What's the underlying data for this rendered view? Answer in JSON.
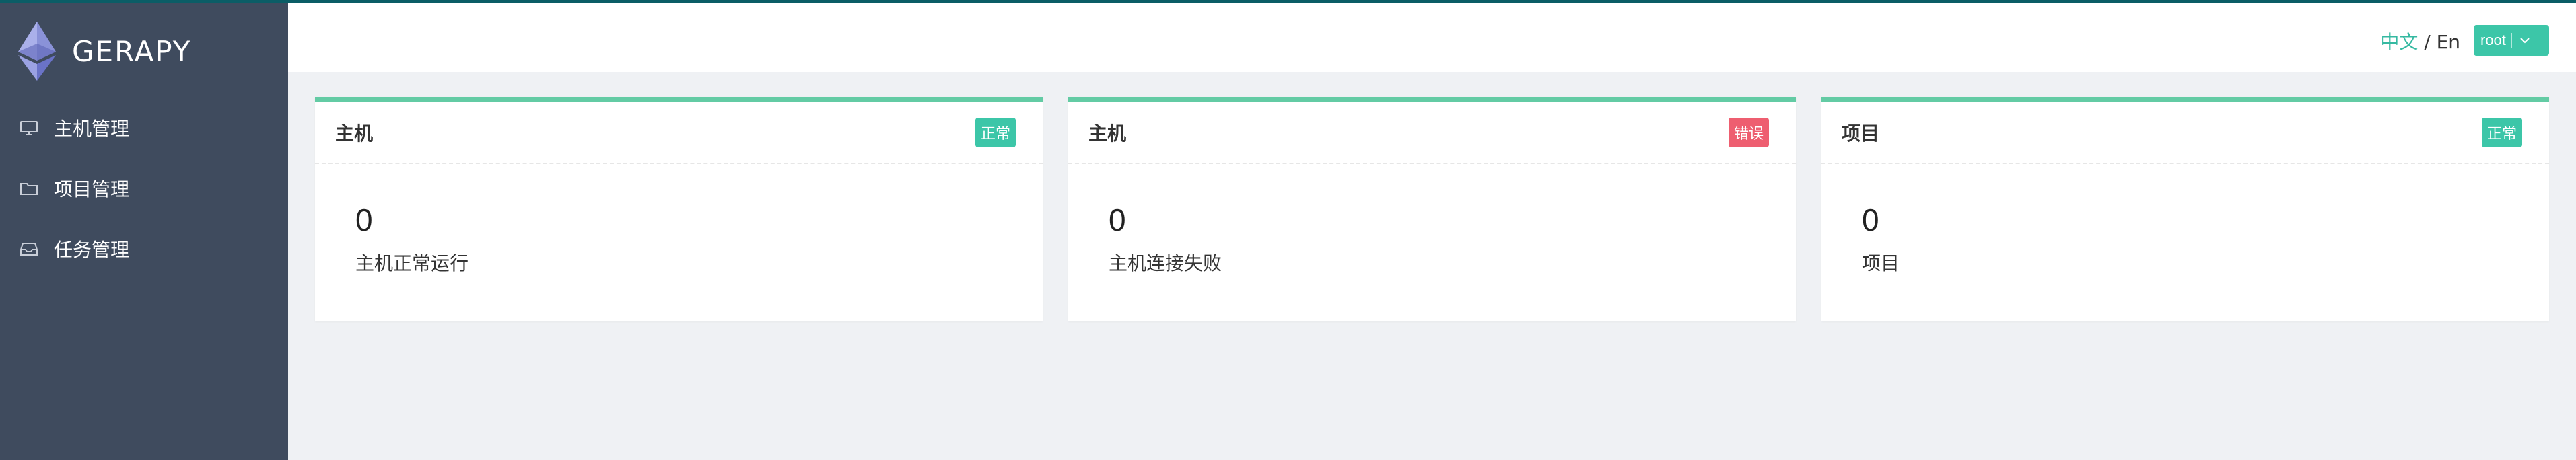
{
  "brand": {
    "name": "GERAPY"
  },
  "sidebar": {
    "items": [
      {
        "label": "主机管理",
        "icon": "monitor-icon"
      },
      {
        "label": "项目管理",
        "icon": "folder-icon"
      },
      {
        "label": "任务管理",
        "icon": "inbox-icon"
      }
    ]
  },
  "header": {
    "lang_zh": "中文",
    "lang_sep": " / ",
    "lang_en": "En",
    "user": "root"
  },
  "cards": [
    {
      "title": "主机",
      "badge": "正常",
      "value": "0",
      "desc": "主机正常运行"
    },
    {
      "title": "主机",
      "badge": "错误",
      "value": "0",
      "desc": "主机连接失败"
    },
    {
      "title": "项目",
      "badge": "正常",
      "value": "0",
      "desc": "项目"
    }
  ],
  "colors": {
    "sidebar_bg": "#3f4b5e",
    "accent": "#3cc6a8",
    "card_top": "#63cba4",
    "error": "#ee5e70",
    "page_bg": "#eff1f4"
  }
}
